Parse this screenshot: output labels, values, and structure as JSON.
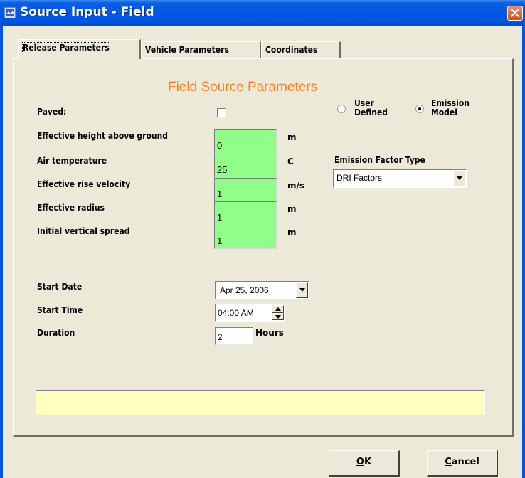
{
  "window": {
    "title": "Source Input - Field"
  },
  "tabs": [
    {
      "label": "Release Parameters",
      "active": true
    },
    {
      "label": "Vehicle Parameters",
      "active": false
    },
    {
      "label": "Coordinates",
      "active": false
    }
  ],
  "section_title": "Field Source Parameters",
  "paved": {
    "label": "Paved:",
    "checked": false
  },
  "source_mode": {
    "user_defined": {
      "line1": "User",
      "line2": "Defined",
      "selected": false
    },
    "emission_model": {
      "line1": "Emission",
      "line2": "Model",
      "selected": true
    }
  },
  "fields": [
    {
      "label": "Effective height above ground",
      "value": "0",
      "unit": "m"
    },
    {
      "label": "Air temperature",
      "value": "25",
      "unit": "C"
    },
    {
      "label": "Effective rise velocity",
      "value": "1",
      "unit": "m/s"
    },
    {
      "label": "Effective radius",
      "value": "1",
      "unit": "m"
    },
    {
      "label": "Initial vertical spread",
      "value": "1",
      "unit": "m"
    }
  ],
  "emission_factor": {
    "label": "Emission Factor Type",
    "selected": "DRI Factors"
  },
  "start_date": {
    "label": "Start Date",
    "value": "Apr 25, 2006"
  },
  "start_time": {
    "label": "Start Time",
    "value": "04:00 AM"
  },
  "duration": {
    "label": "Duration",
    "value": "2",
    "unit": "Hours"
  },
  "status_message": "",
  "buttons": {
    "ok": {
      "label_underlined": "O",
      "label_rest": "K"
    },
    "cancel": {
      "label_underlined": "C",
      "label_rest": "ancel"
    }
  },
  "colors": {
    "title_bar": "#0055e5",
    "section_title": "#ff7f1f",
    "input_fill": "#90ff8a",
    "status_fill": "#ffffc0",
    "dialog_bg": "#ece9d8"
  }
}
